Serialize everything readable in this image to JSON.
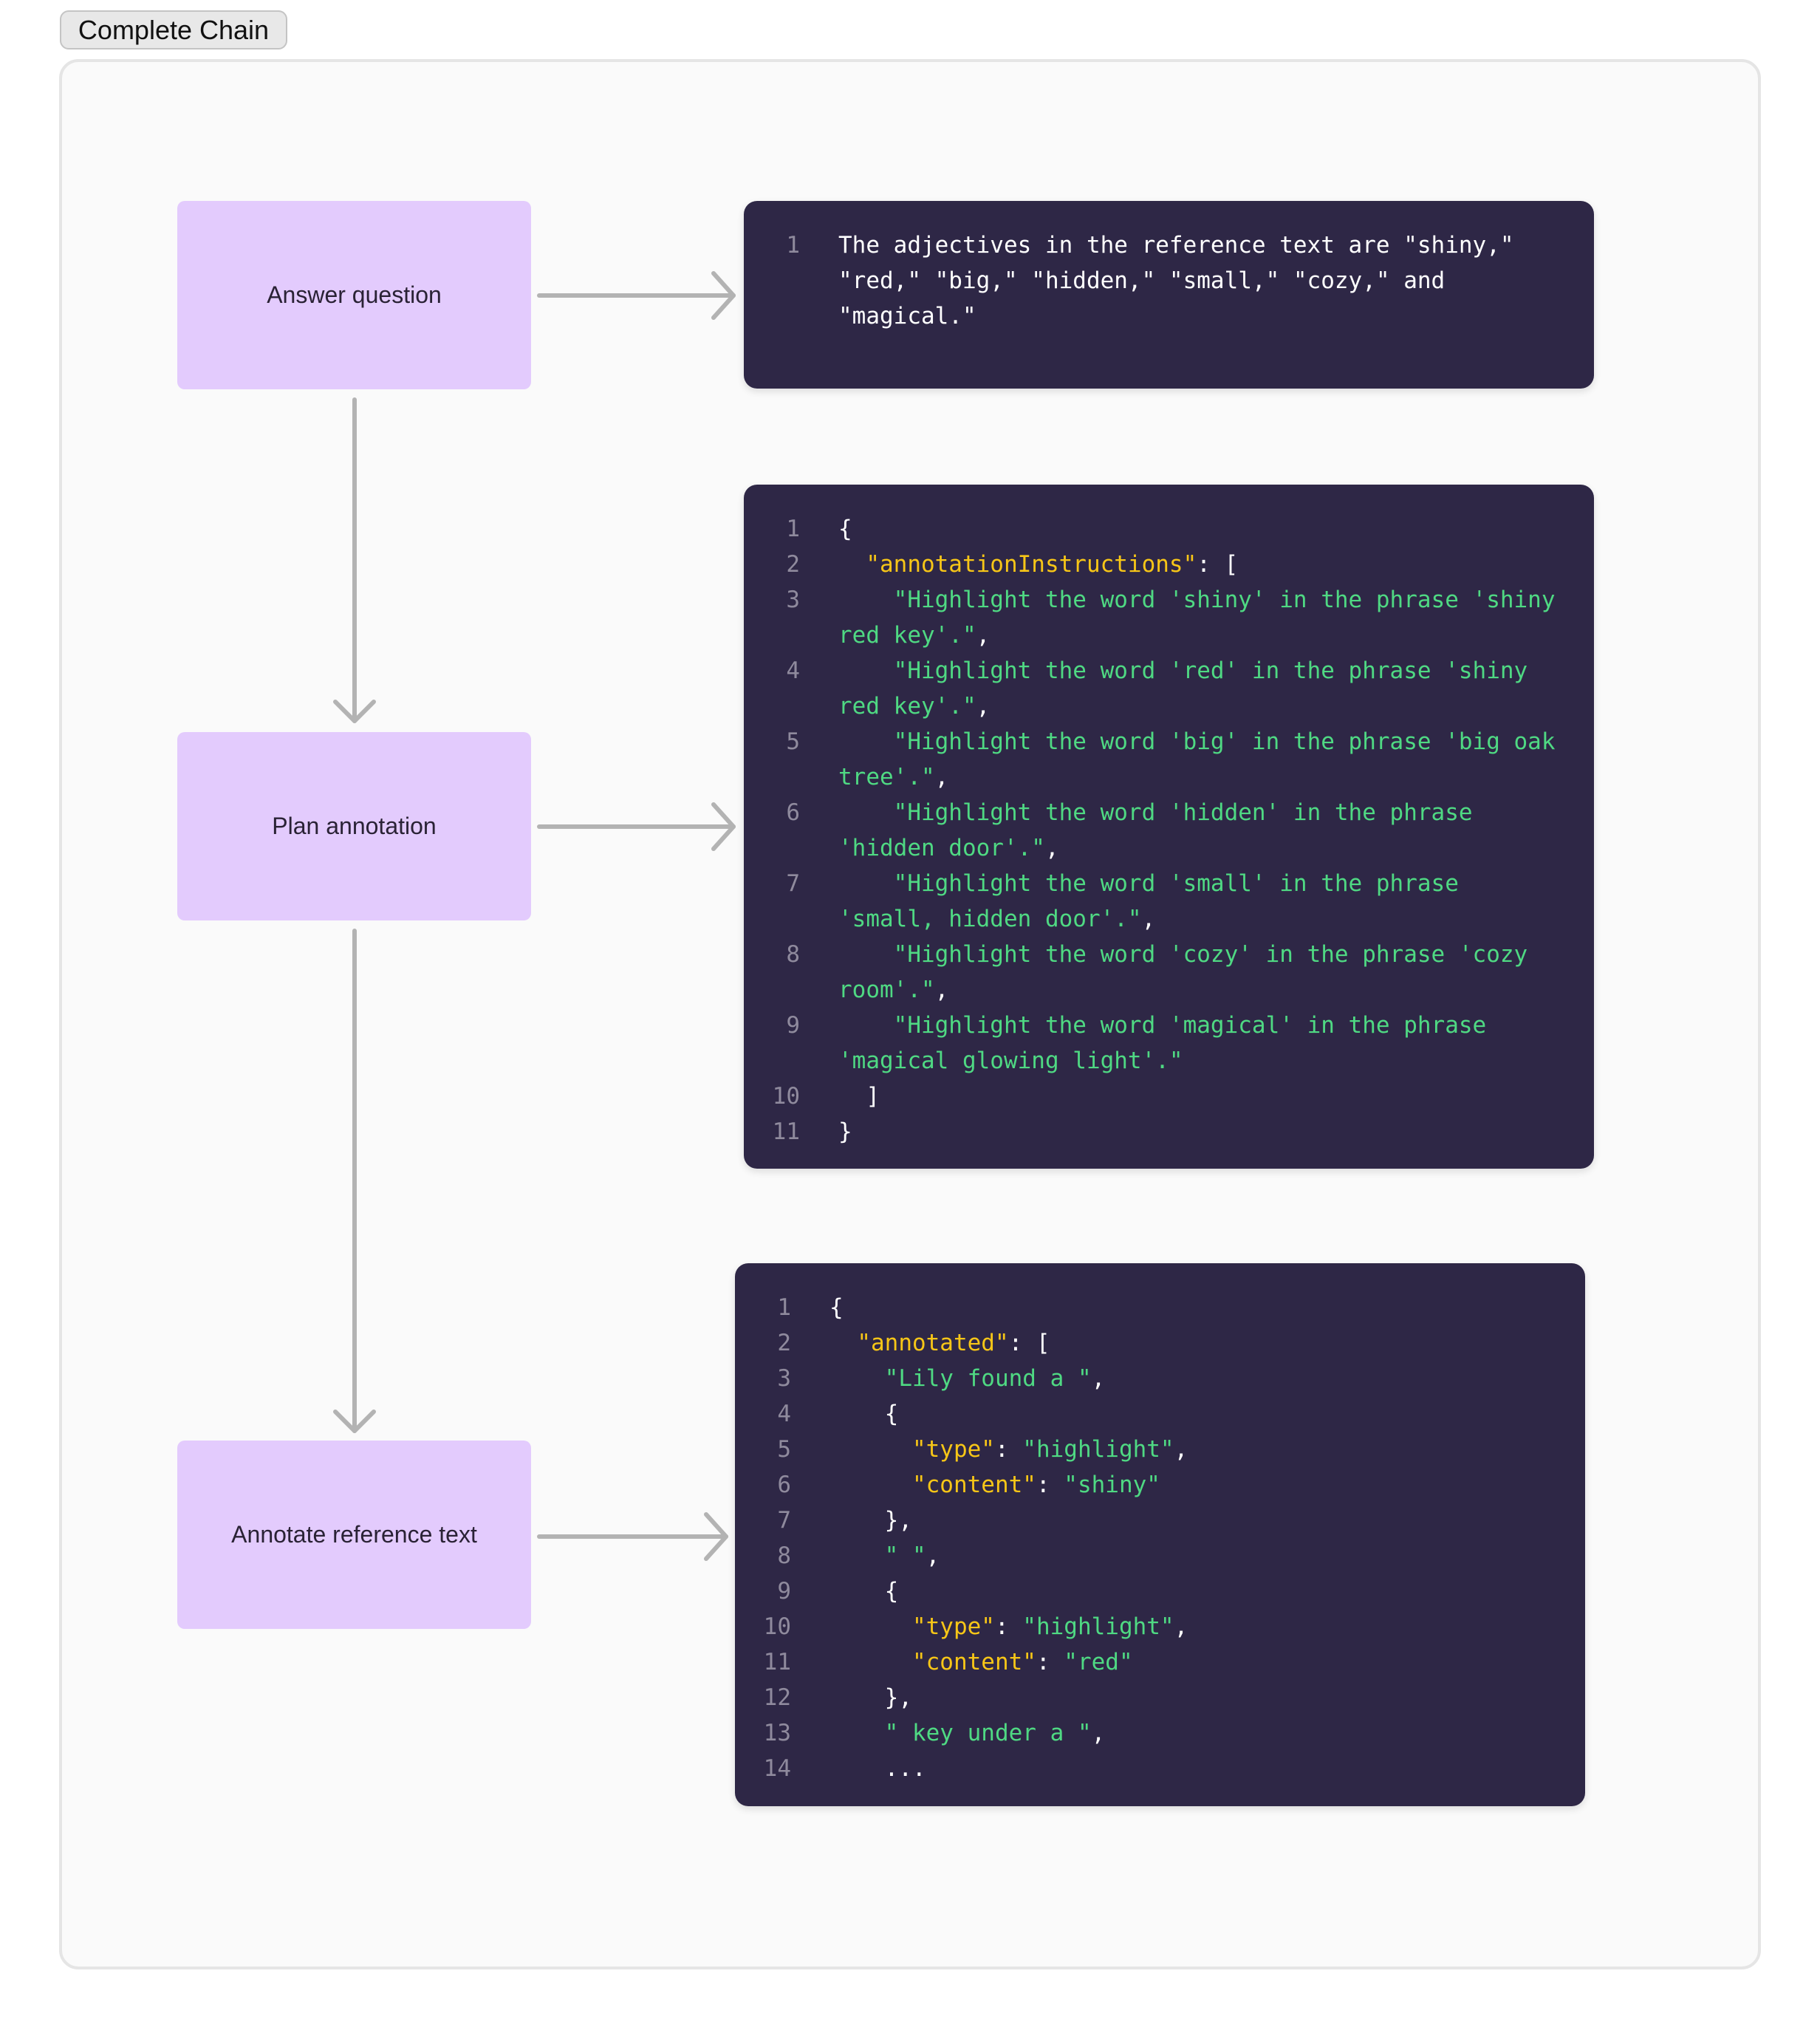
{
  "toolbar": {
    "complete_chain_label": "Complete Chain"
  },
  "colors": {
    "node_fill": "#e3cbfd",
    "code_bg": "#2e2746",
    "key": "#f7c617",
    "string": "#4fd983",
    "punct": "#ffffff",
    "line_number": "#8f8a9d",
    "arrow": "#b3b3b3"
  },
  "nodes": [
    {
      "label": "Answer question"
    },
    {
      "label": "Plan annotation"
    },
    {
      "label": "Annotate reference text"
    }
  ],
  "outputs": [
    {
      "lines": [
        {
          "n": "1",
          "tokens": [
            {
              "t": "p",
              "v": "The adjectives in the reference text are \"shiny,\" \"red,\" \"big,\" \"hidden,\" \"small,\" \"cozy,\" and \"magical.\""
            }
          ]
        }
      ]
    },
    {
      "lines": [
        {
          "n": "1",
          "tokens": [
            {
              "t": "p",
              "v": "{"
            }
          ]
        },
        {
          "n": "2",
          "tokens": [
            {
              "t": "p",
              "v": "  "
            },
            {
              "t": "k",
              "v": "\"annotationInstructions\""
            },
            {
              "t": "p",
              "v": ": ["
            }
          ]
        },
        {
          "n": "3",
          "tokens": [
            {
              "t": "p",
              "v": "    "
            },
            {
              "t": "s",
              "v": "\"Highlight the word 'shiny' in the phrase 'shiny red key'.\""
            },
            {
              "t": "p",
              "v": ","
            }
          ]
        },
        {
          "n": "4",
          "tokens": [
            {
              "t": "p",
              "v": "    "
            },
            {
              "t": "s",
              "v": "\"Highlight the word 'red' in the phrase 'shiny red key'.\""
            },
            {
              "t": "p",
              "v": ","
            }
          ]
        },
        {
          "n": "5",
          "tokens": [
            {
              "t": "p",
              "v": "    "
            },
            {
              "t": "s",
              "v": "\"Highlight the word 'big' in the phrase 'big oak tree'.\""
            },
            {
              "t": "p",
              "v": ","
            }
          ]
        },
        {
          "n": "6",
          "tokens": [
            {
              "t": "p",
              "v": "    "
            },
            {
              "t": "s",
              "v": "\"Highlight the word 'hidden' in the phrase 'hidden door'.\""
            },
            {
              "t": "p",
              "v": ","
            }
          ]
        },
        {
          "n": "7",
          "tokens": [
            {
              "t": "p",
              "v": "    "
            },
            {
              "t": "s",
              "v": "\"Highlight the word 'small' in the phrase 'small, hidden door'.\""
            },
            {
              "t": "p",
              "v": ","
            }
          ]
        },
        {
          "n": "8",
          "tokens": [
            {
              "t": "p",
              "v": "    "
            },
            {
              "t": "s",
              "v": "\"Highlight the word 'cozy' in the phrase 'cozy room'.\""
            },
            {
              "t": "p",
              "v": ","
            }
          ]
        },
        {
          "n": "9",
          "tokens": [
            {
              "t": "p",
              "v": "    "
            },
            {
              "t": "s",
              "v": "\"Highlight the word 'magical' in the phrase 'magical glowing light'.\""
            }
          ]
        },
        {
          "n": "10",
          "tokens": [
            {
              "t": "p",
              "v": "  ]"
            }
          ]
        },
        {
          "n": "11",
          "tokens": [
            {
              "t": "p",
              "v": "}"
            }
          ]
        }
      ]
    },
    {
      "lines": [
        {
          "n": "1",
          "tokens": [
            {
              "t": "p",
              "v": "{"
            }
          ]
        },
        {
          "n": "2",
          "tokens": [
            {
              "t": "p",
              "v": "  "
            },
            {
              "t": "k",
              "v": "\"annotated\""
            },
            {
              "t": "p",
              "v": ": ["
            }
          ]
        },
        {
          "n": "3",
          "tokens": [
            {
              "t": "p",
              "v": "    "
            },
            {
              "t": "s",
              "v": "\"Lily found a \""
            },
            {
              "t": "p",
              "v": ","
            }
          ]
        },
        {
          "n": "4",
          "tokens": [
            {
              "t": "p",
              "v": "    {"
            }
          ]
        },
        {
          "n": "5",
          "tokens": [
            {
              "t": "p",
              "v": "      "
            },
            {
              "t": "k",
              "v": "\"type\""
            },
            {
              "t": "p",
              "v": ": "
            },
            {
              "t": "s",
              "v": "\"highlight\""
            },
            {
              "t": "p",
              "v": ","
            }
          ]
        },
        {
          "n": "6",
          "tokens": [
            {
              "t": "p",
              "v": "      "
            },
            {
              "t": "k",
              "v": "\"content\""
            },
            {
              "t": "p",
              "v": ": "
            },
            {
              "t": "s",
              "v": "\"shiny\""
            }
          ]
        },
        {
          "n": "7",
          "tokens": [
            {
              "t": "p",
              "v": "    },"
            }
          ]
        },
        {
          "n": "8",
          "tokens": [
            {
              "t": "p",
              "v": "    "
            },
            {
              "t": "s",
              "v": "\" \""
            },
            {
              "t": "p",
              "v": ","
            }
          ]
        },
        {
          "n": "9",
          "tokens": [
            {
              "t": "p",
              "v": "    {"
            }
          ]
        },
        {
          "n": "10",
          "tokens": [
            {
              "t": "p",
              "v": "      "
            },
            {
              "t": "k",
              "v": "\"type\""
            },
            {
              "t": "p",
              "v": ": "
            },
            {
              "t": "s",
              "v": "\"highlight\""
            },
            {
              "t": "p",
              "v": ","
            }
          ]
        },
        {
          "n": "11",
          "tokens": [
            {
              "t": "p",
              "v": "      "
            },
            {
              "t": "k",
              "v": "\"content\""
            },
            {
              "t": "p",
              "v": ": "
            },
            {
              "t": "s",
              "v": "\"red\""
            }
          ]
        },
        {
          "n": "12",
          "tokens": [
            {
              "t": "p",
              "v": "    },"
            }
          ]
        },
        {
          "n": "13",
          "tokens": [
            {
              "t": "p",
              "v": "    "
            },
            {
              "t": "s",
              "v": "\" key under a \""
            },
            {
              "t": "p",
              "v": ","
            }
          ]
        },
        {
          "n": "14",
          "tokens": [
            {
              "t": "p",
              "v": "    ..."
            }
          ]
        }
      ]
    }
  ],
  "edges": [
    {
      "from": "node-0",
      "to": "output-0",
      "kind": "output"
    },
    {
      "from": "node-0",
      "to": "node-1",
      "kind": "next"
    },
    {
      "from": "node-1",
      "to": "output-1",
      "kind": "output"
    },
    {
      "from": "node-1",
      "to": "node-2",
      "kind": "next"
    },
    {
      "from": "node-2",
      "to": "output-2",
      "kind": "output"
    }
  ]
}
